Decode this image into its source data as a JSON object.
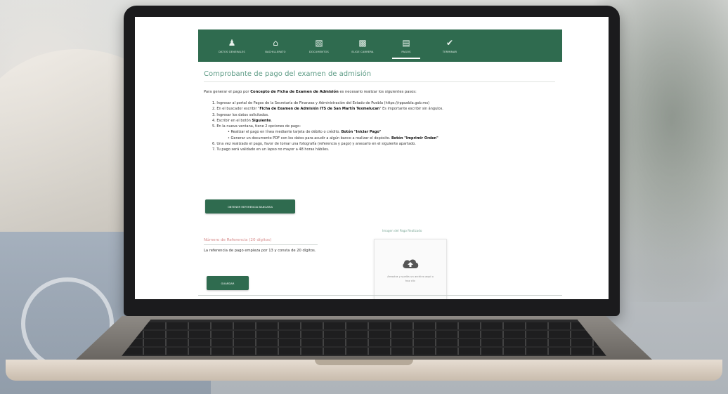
{
  "colors": {
    "nav_bg": "#2f6b4f",
    "title": "#5e9c86",
    "ref_label": "#d68a8a",
    "button": "#2f6b4f"
  },
  "nav": {
    "items": [
      {
        "icon": "user-icon",
        "label": "DATOS GENERALES",
        "active": false
      },
      {
        "icon": "school-icon",
        "label": "BACHILLERATO",
        "active": false
      },
      {
        "icon": "document-icon",
        "label": "DOCUMENTOS",
        "active": false
      },
      {
        "icon": "career-icon",
        "label": "ELIGE CARRERA",
        "active": false
      },
      {
        "icon": "payment-icon",
        "label": "PAGOS",
        "active": true
      },
      {
        "icon": "check-icon",
        "label": "TERMINAR",
        "active": false
      }
    ]
  },
  "page": {
    "title": "Comprobante de pago del examen de admisión",
    "intro_pre": "Para generar el pago por ",
    "intro_bold": "Concepto de Ficha de Examen de Admisión",
    "intro_post": " es necesario realizar los siguientes pasos:",
    "steps": [
      {
        "pre": "1. Ingresar al portal de Pagos de la Secretaría de Finanzas y Administración del Estado de Puebla (https://rppuebla.gob.mx)",
        "bold": "",
        "post": ""
      },
      {
        "pre": "2. En el buscador escribir \"",
        "bold": "Ficha de Examen de Admisión ITS de San Martín Texmelucan",
        "post": "\" Es importante escribir sin ángulos."
      },
      {
        "pre": "3. Ingresar los datos solicitados.",
        "bold": "",
        "post": ""
      },
      {
        "pre": "4. Escribir en el botón ",
        "bold": "Siguiente",
        "post": "."
      },
      {
        "pre": "5. En la nueva ventana, tiene 2 opciones de pago:",
        "bold": "",
        "post": ""
      }
    ],
    "substeps": [
      {
        "pre": "• Realizar el pago en línea mediante tarjeta de débito o crédito. ",
        "bold": "Botón \"Iniciar Pago\"",
        "post": ""
      },
      {
        "pre": "• Generar un documento PDF con los datos para acudir a algún banco a realizar el depósito. ",
        "bold": "Botón \"Imprimir Orden\"",
        "post": ""
      }
    ],
    "steps_after": [
      {
        "pre": "6. Una vez realizado el pago, favor de tomar una fotografía (referencia y pago) y anexarlo en el siguiente apartado.",
        "bold": "",
        "post": ""
      },
      {
        "pre": "7. Tu pago será validado en un lapso no mayor a 48 horas hábiles.",
        "bold": "",
        "post": ""
      }
    ],
    "ref_button_label": "OBTENER REFERENCIA BANCARIA",
    "ref_field_label": "Número de Referencia (20 dígitos)",
    "ref_help": "La referencia de pago empieza por 13 y consta de 20 dígitos.",
    "save_button_label": "GUARDAR",
    "upload_label": "Imagen del Pago Realizado",
    "upload_icon": "cloud-upload-icon",
    "upload_hint": "Arrastra y suelta un archivo aquí o haz clic"
  }
}
